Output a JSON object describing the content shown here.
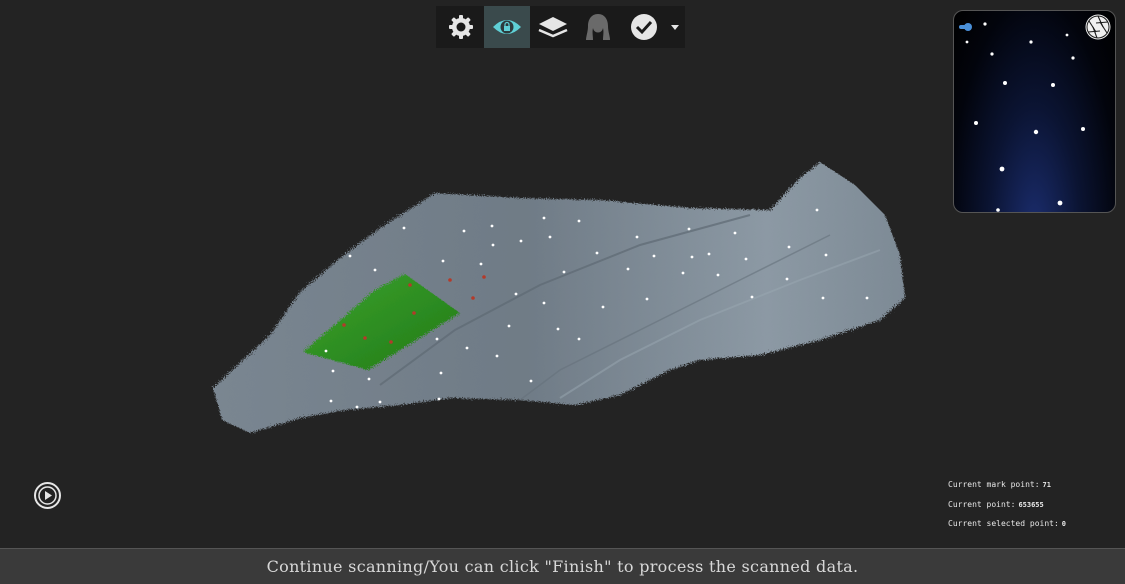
{
  "toolbar": {
    "buttons": [
      {
        "icon": "gear-icon"
      },
      {
        "icon": "eye-lock-icon",
        "active": true
      },
      {
        "icon": "layers-icon"
      },
      {
        "icon": "head-profile-icon"
      },
      {
        "icon": "check-circle-icon"
      }
    ],
    "accent_color": "#5fd0d6"
  },
  "info": {
    "mark_point_label": "Current mark point:",
    "mark_point_value": "71",
    "point_label": "Current point:",
    "point_value": "653655",
    "selected_label": "Current selected point:",
    "selected_value": "0"
  },
  "status": {
    "message": "Continue scanning/You can click \"Finish\" to process the scanned data."
  },
  "colors": {
    "background": "#232323",
    "scan_surface": "#7f8c97",
    "selection": "#2f8f22",
    "status_bar": "#3a3a3a"
  }
}
